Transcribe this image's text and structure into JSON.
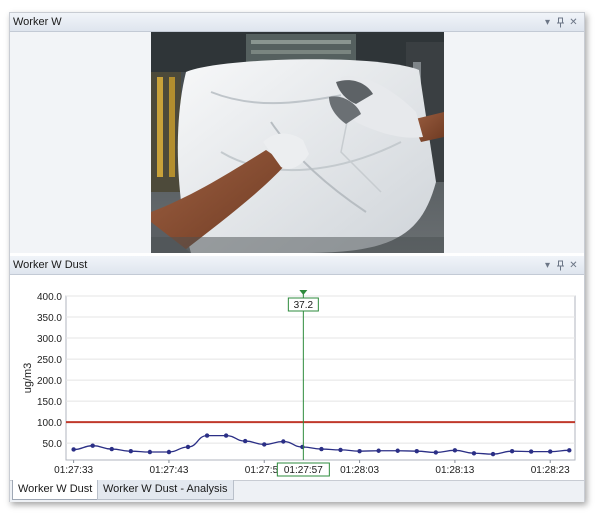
{
  "video_panel": {
    "title": "Worker W",
    "controls": {
      "dropdown_icon": "▾",
      "pin_icon": "⊥",
      "close_icon": "✕"
    }
  },
  "dust_panel": {
    "title": "Worker W Dust",
    "controls": {
      "dropdown_icon": "▾",
      "pin_icon": "⊥",
      "close_icon": "✕"
    }
  },
  "cursor": {
    "value_label": "37.2",
    "time_label": "01:27:57",
    "color": "#2e8b3c"
  },
  "colors": {
    "series": "#2b2f86",
    "threshold": "#c0392b",
    "cursor": "#2e8b3c",
    "grid": "#e4e4e4"
  },
  "tabs": [
    {
      "label": "Worker W Dust",
      "active": true
    },
    {
      "label": "Worker W Dust - Analysis",
      "active": false
    }
  ],
  "chart_data": {
    "type": "line",
    "ylabel": "ug/m3",
    "y_ticks": [
      "400.0",
      "350.0",
      "300.0",
      "250.0",
      "200.0",
      "150.0",
      "100.0",
      "50.0"
    ],
    "x_ticks": [
      "01:27:33",
      "01:27:43",
      "01:27:53",
      "01:28:03",
      "01:28:13",
      "01:28:23"
    ],
    "x_tick_seconds": [
      0,
      10,
      20,
      30,
      40,
      50
    ],
    "ylim": [
      10,
      400
    ],
    "xlim_seconds": [
      -0.8,
      52.6
    ],
    "threshold": 100,
    "cursor_x_seconds": 24.1,
    "series": [
      {
        "x_seconds": [
          0,
          2,
          4,
          6,
          8,
          10,
          12,
          14,
          16,
          18,
          20,
          22,
          24,
          26,
          28,
          30,
          32,
          34,
          36,
          38,
          40,
          42,
          44,
          46,
          48,
          50,
          52
        ],
        "values": [
          35,
          44,
          36,
          31,
          29,
          29,
          41,
          68,
          68,
          55,
          47,
          54,
          41,
          36,
          34,
          31,
          32,
          32,
          31,
          28,
          33,
          26,
          24,
          31,
          30,
          30,
          33
        ]
      }
    ],
    "grid": true
  }
}
